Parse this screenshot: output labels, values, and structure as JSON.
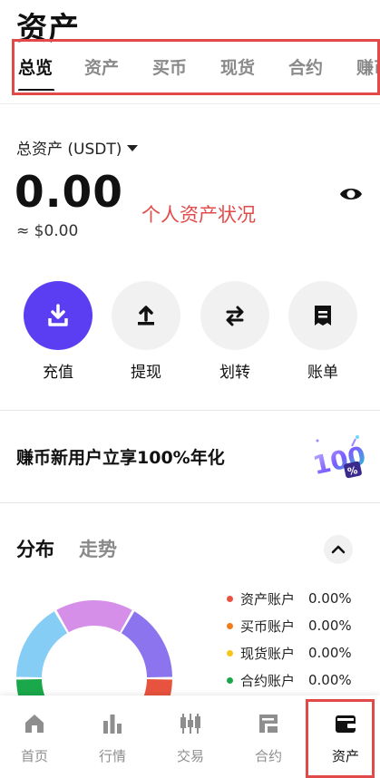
{
  "page": {
    "title": "资产"
  },
  "tabs": [
    {
      "label": "总览",
      "active": true
    },
    {
      "label": "资产",
      "active": false
    },
    {
      "label": "买币",
      "active": false
    },
    {
      "label": "现货",
      "active": false
    },
    {
      "label": "合约",
      "active": false
    },
    {
      "label": "赚币",
      "active": false
    }
  ],
  "overview": {
    "total_label": "总资产 (USDT)",
    "total_value": "0.00",
    "approx_value": "≈ $0.00",
    "annotation": "个人资产状况"
  },
  "actions": [
    {
      "label": "充值",
      "icon": "deposit-icon"
    },
    {
      "label": "提现",
      "icon": "withdraw-icon"
    },
    {
      "label": "划转",
      "icon": "transfer-icon"
    },
    {
      "label": "账单",
      "icon": "bill-icon"
    }
  ],
  "promo": {
    "text": "赚币新用户立享100%年化"
  },
  "distribution": {
    "tabs": [
      {
        "label": "分布",
        "active": true
      },
      {
        "label": "走势",
        "active": false
      }
    ],
    "legend": [
      {
        "name": "资产账户",
        "value": "0.00%",
        "color": "#e8533f"
      },
      {
        "name": "买币账户",
        "value": "0.00%",
        "color": "#f07c1c"
      },
      {
        "name": "现货账户",
        "value": "0.00%",
        "color": "#f5c518"
      },
      {
        "name": "合约账户",
        "value": "0.00%",
        "color": "#1aa84a"
      }
    ],
    "ring_colors": [
      "#1aa84a",
      "#86cdf5",
      "#d58fe8",
      "#8b74ee",
      "#e8533f"
    ]
  },
  "nav": [
    {
      "label": "首页",
      "icon": "home-icon",
      "active": false
    },
    {
      "label": "行情",
      "icon": "market-icon",
      "active": false
    },
    {
      "label": "交易",
      "icon": "trade-icon",
      "active": false
    },
    {
      "label": "合约",
      "icon": "contract-icon",
      "active": false
    },
    {
      "label": "资产",
      "icon": "wallet-icon",
      "active": true
    }
  ]
}
